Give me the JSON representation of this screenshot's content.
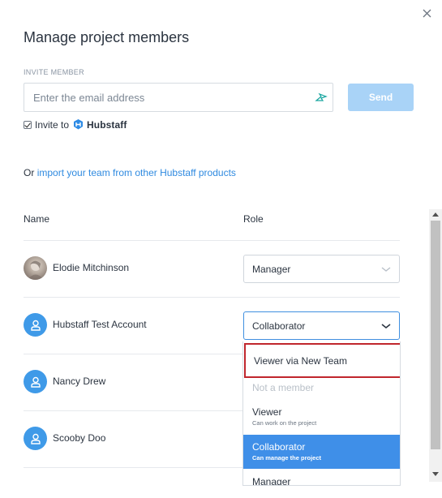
{
  "modal": {
    "title": "Manage project members",
    "close_icon": "close-icon"
  },
  "invite": {
    "section_label": "INVITE MEMBER",
    "email_placeholder": "Enter the email address",
    "email_value": "",
    "send_label": "Send",
    "send_color": "#a9d3f7",
    "invite_to_label": "Invite to",
    "invite_checked": true,
    "brand_name": "Hubstaff"
  },
  "import": {
    "prefix": "Or",
    "link_text": "import your team from other Hubstaff products"
  },
  "table": {
    "col_name": "Name",
    "col_role": "Role",
    "members": [
      {
        "name": "Elodie Mitchinson",
        "role": "Manager",
        "avatar": "photo-avatar"
      },
      {
        "name": "Hubstaff Test Account",
        "role": "Collaborator",
        "avatar": "user-icon"
      },
      {
        "name": "Nancy Drew",
        "role": "",
        "avatar": "user-icon"
      },
      {
        "name": "Scooby Doo",
        "role": "",
        "avatar": "user-icon"
      }
    ]
  },
  "dropdown": {
    "options": [
      {
        "label": "Viewer via New Team",
        "sub": "",
        "state": "highlighted"
      },
      {
        "label": "Not a member",
        "sub": "",
        "state": "disabled"
      },
      {
        "label": "Viewer",
        "sub": "Can work on the project",
        "state": "normal"
      },
      {
        "label": "Collaborator",
        "sub": "Can manage the project",
        "state": "selected"
      },
      {
        "label": "Manager",
        "sub": "",
        "state": "normal"
      }
    ],
    "selected_color": "#3f8fe8",
    "highlight_color": "#c0262d"
  },
  "colors": {
    "accent": "#2f8ae0",
    "avatar_blue": "#3f9ae8"
  }
}
